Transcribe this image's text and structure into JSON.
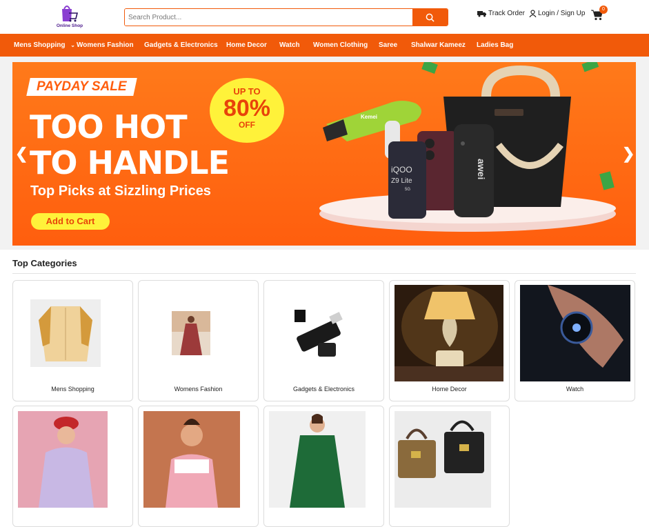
{
  "brand": {
    "name": "Online Shop",
    "accent": "#f15a0a",
    "logo_color": "#8a3fd1"
  },
  "search": {
    "placeholder": "Search Product..."
  },
  "header_links": {
    "track_order": "Track Order",
    "login": "Login / Sign Up",
    "cart_count": "0"
  },
  "nav": [
    "Mens Shopping",
    "Womens Fashion",
    "Gadgets & Electronics",
    "Home Decor",
    "Watch",
    "Women Clothing",
    "Saree",
    "Shalwar Kameez",
    "Ladies Bag"
  ],
  "hero": {
    "tag": "PAYDAY SALE",
    "headline_1": "TOO HOT",
    "headline_2": "TO HANDLE",
    "subline": "Top Picks at Sizzling Prices",
    "cta": "Add to Cart",
    "discount_top": "UP TO",
    "discount_value": "80%",
    "discount_bottom": "OFF",
    "phone_brand": "iQOO",
    "phone_model": "Z9 Lite",
    "phone_badge": "5G",
    "speaker_brand": "awei",
    "dryer_brand": "Kemei"
  },
  "categories": {
    "title": "Top Categories",
    "items": [
      "Mens Shopping",
      "Womens Fashion",
      "Gadgets & Electronics",
      "Home Decor",
      "Watch",
      "",
      "",
      "",
      ""
    ]
  }
}
